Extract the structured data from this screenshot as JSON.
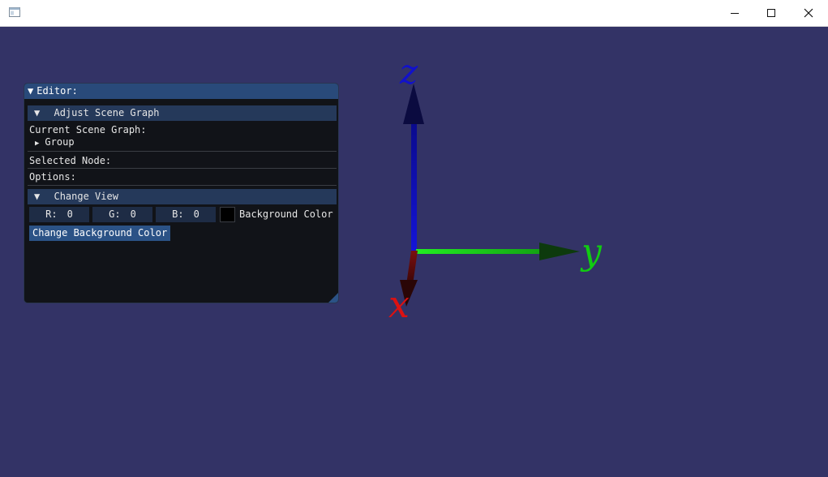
{
  "titlebar": {
    "icon": "app-window-icon",
    "minimize_icon": "minimize-icon",
    "maximize_icon": "maximize-icon",
    "close_icon": "close-icon"
  },
  "editor": {
    "title": "Editor:",
    "scene_section": {
      "header": "Adjust Scene Graph",
      "current_label": "Current Scene Graph:",
      "tree_root": "Group",
      "selected_label": "Selected Node:",
      "options_label": "Options:"
    },
    "view_section": {
      "header": "Change View",
      "r_label": "R:",
      "r_value": "0",
      "g_label": "G:",
      "g_value": "0",
      "b_label": "B:",
      "b_value": "0",
      "color_label": "Background Color",
      "swatch_color": "#000000",
      "button": "Change Background Color"
    }
  },
  "scene": {
    "background": "#333366",
    "axes": {
      "x_label": "x",
      "y_label": "y",
      "z_label": "z",
      "x_color": "#cc1111",
      "y_color": "#11cc11",
      "z_color": "#1111cc"
    }
  }
}
